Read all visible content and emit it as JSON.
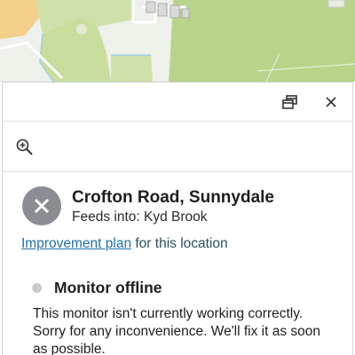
{
  "map": {
    "colors": {
      "park": "#cfe0a8",
      "park_dark": "#b8d48a",
      "water": "#b4e0f0",
      "sand": "#f4cf8a",
      "road": "#ffffff",
      "building": "#d9d9d9"
    }
  },
  "toolbar": {
    "restore_icon": "restore-window-icon",
    "close_icon": "close-icon"
  },
  "zoom": {
    "icon": "zoom-in-icon"
  },
  "location": {
    "title": "Crofton Road, Sunnydale",
    "feeds_into": "Feeds into: Kyd Brook",
    "status_icon": "offline-x-icon",
    "status_color": "#8a8d91"
  },
  "plan": {
    "link_label": "Improvement plan",
    "suffix": " for this location",
    "link_color": "#1f6fa8"
  },
  "monitor": {
    "title": "Monitor offline",
    "status_dot_color": "#c9c9c9",
    "message": "This monitor isn't currently working correctly. Sorry for any inconvenience. We'll fix it as soon as possible."
  }
}
